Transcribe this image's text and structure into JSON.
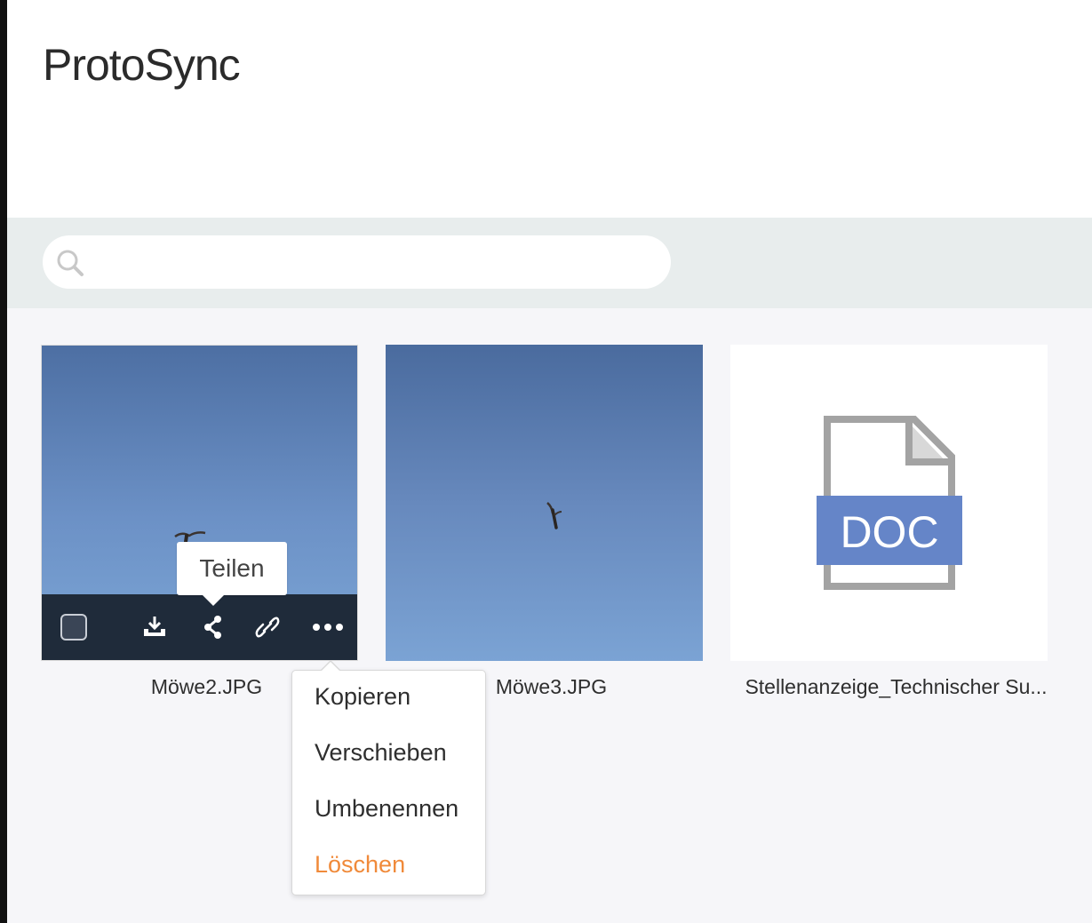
{
  "app": {
    "title": "ProtoSync"
  },
  "search": {
    "placeholder": "",
    "value": ""
  },
  "files": [
    {
      "name": "Möwe2.JPG",
      "type": "image"
    },
    {
      "name": "Möwe3.JPG",
      "type": "image"
    },
    {
      "name": "Stellenanzeige_Technischer Su...",
      "type": "doc",
      "badge": "DOC"
    }
  ],
  "tooltip": {
    "label": "Teilen"
  },
  "action_bar": {
    "icons": [
      "checkbox",
      "download-icon",
      "share-icon",
      "link-icon",
      "more-icon"
    ]
  },
  "context_menu": {
    "items": [
      {
        "label": "Kopieren"
      },
      {
        "label": "Verschieben"
      },
      {
        "label": "Umbenennen"
      },
      {
        "label": "Löschen",
        "color": "#f08a3a"
      }
    ]
  },
  "colors": {
    "doc_badge": "#6585c8",
    "action_bar": "#1f2b3a",
    "delete": "#f08a3a"
  }
}
